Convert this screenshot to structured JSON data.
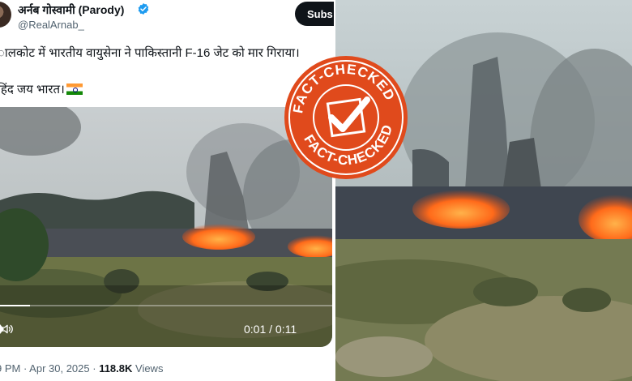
{
  "tweet": {
    "display_name": "अर्नब गोस्वामी (Parody)",
    "handle": "@RealArnab_",
    "subscribe_label": "Subs",
    "text_line1": "ालकोट में भारतीय वायुसेना ने पाकिस्तानी F-16 जेट को मार गिराया।",
    "text_line2": "हिंद जय भारत।",
    "meta_time": "9 PM · Apr 30, 2025 · ",
    "meta_views_count": "118.8K",
    "meta_views_label": " Views"
  },
  "video": {
    "time": "0:01 / 0:11",
    "progress": 0.09
  },
  "stamp": {
    "label": "FACT-CHECKED",
    "color": "#e04a1c"
  },
  "icons": {
    "verified": "verified-badge-icon",
    "flag": "india-flag-icon",
    "play": "play-icon",
    "volume": "volume-icon",
    "stamp_check": "check-mark-icon"
  },
  "colors": {
    "verified_blue": "#1d9bf0",
    "fire_orange": "#ff6a1a",
    "text_primary": "#0f1419",
    "text_secondary": "#536471"
  }
}
